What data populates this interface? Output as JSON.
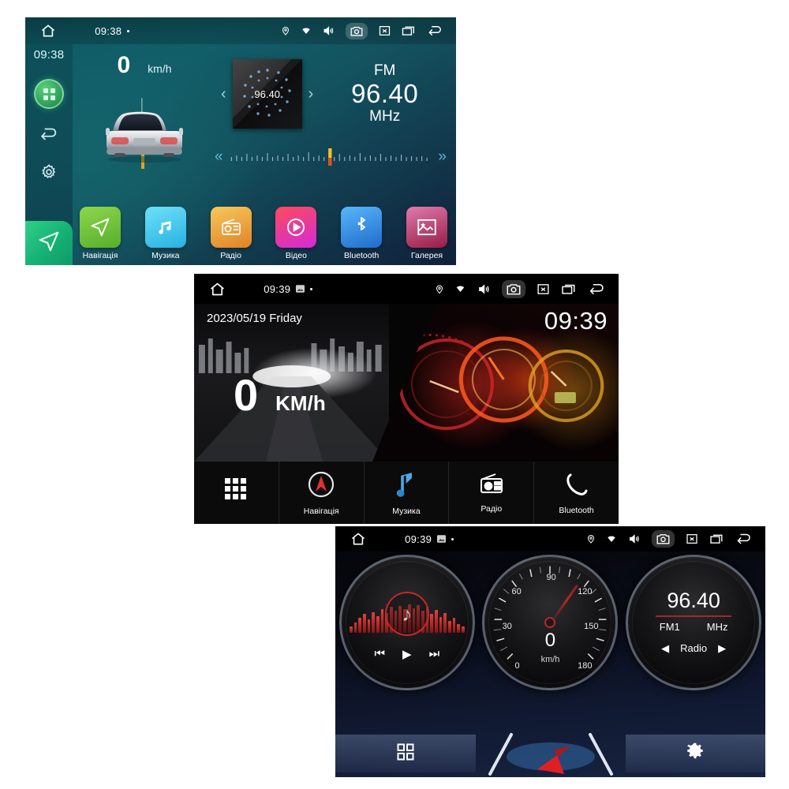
{
  "screens": [
    {
      "id": "home-teal",
      "statusbar": {
        "time": "09:38",
        "icons": [
          "home-icon",
          "screenshot-indicator-icon",
          "dot-icon",
          "location-icon",
          "wifi-icon",
          "volume-icon",
          "camera-icon",
          "close-icon",
          "recents-icon",
          "back-icon"
        ]
      },
      "sidebar": {
        "time": "09:38",
        "items": [
          "apps-grid-icon",
          "back-icon",
          "settings-gear-icon",
          "navigation-arrow-icon"
        ]
      },
      "speed": {
        "value": "0",
        "unit": "km/h"
      },
      "radio": {
        "album_freq": "96.40",
        "band": "FM",
        "frequency": "96.40",
        "unit": "MHz",
        "prev_label": "‹",
        "next_label": "›",
        "seek_back": "«",
        "seek_fwd": "»"
      },
      "apps": [
        {
          "label": "Навігація",
          "icon": "navigation-icon",
          "color": "#7ec93f",
          "color2": "#4da52a"
        },
        {
          "label": "Музика",
          "icon": "music-note-icon",
          "color": "#4fd2f0",
          "color2": "#2ab4e0"
        },
        {
          "label": "Радіо",
          "icon": "radio-icon",
          "color": "#f2b94a",
          "color2": "#e0862a"
        },
        {
          "label": "Відео",
          "icon": "video-play-icon",
          "color": "#f5475e",
          "color2": "#d92fd4"
        },
        {
          "label": "Bluetooth",
          "icon": "bluetooth-icon",
          "color": "#3fa9f5",
          "color2": "#1f6fd0"
        },
        {
          "label": "Галерея",
          "icon": "gallery-icon",
          "color": "#d96ba0",
          "color2": "#9c1f45"
        }
      ]
    },
    {
      "id": "dashboard-black",
      "statusbar": {
        "time": "09:39",
        "icons": [
          "home-icon",
          "screenshot-indicator-icon",
          "dot-icon",
          "location-icon",
          "wifi-icon",
          "volume-icon",
          "camera-icon",
          "close-icon",
          "recents-icon",
          "back-icon"
        ]
      },
      "date": "2023/05/19 Friday",
      "clock": "09:39",
      "speed": {
        "value": "0",
        "unit": "KM/h"
      },
      "dock": [
        {
          "label": "",
          "icon": "apps-grid-icon"
        },
        {
          "label": "Навігація",
          "icon": "compass-icon"
        },
        {
          "label": "Музика",
          "icon": "music-note-icon"
        },
        {
          "label": "Радіо",
          "icon": "radio-icon"
        },
        {
          "label": "Bluetooth",
          "icon": "phone-icon"
        }
      ]
    },
    {
      "id": "gauges-darkblue",
      "statusbar": {
        "time": "09:39",
        "icons": [
          "home-icon",
          "screenshot-indicator-icon",
          "dot-icon",
          "location-icon",
          "wifi-icon",
          "volume-icon",
          "camera-icon",
          "close-icon",
          "recents-icon",
          "back-icon"
        ]
      },
      "music_gauge": {
        "icon": "music-note-icon",
        "prev": "⏮",
        "play": "▶",
        "next": "⏭"
      },
      "speed_gauge": {
        "value": "0",
        "unit": "km/h",
        "ticks": [
          "0",
          "30",
          "60",
          "90",
          "120",
          "150",
          "180"
        ],
        "min": 0,
        "max": 180
      },
      "radio_gauge": {
        "frequency": "96.40",
        "band": "FM1",
        "unit": "MHz",
        "label": "Radio",
        "prev": "◀",
        "next": "▶"
      },
      "bottombar": [
        {
          "icon": "apps-grid-icon"
        },
        {
          "icon": "navigation-arrow-icon"
        },
        {
          "icon": "settings-gear-icon"
        }
      ]
    }
  ]
}
